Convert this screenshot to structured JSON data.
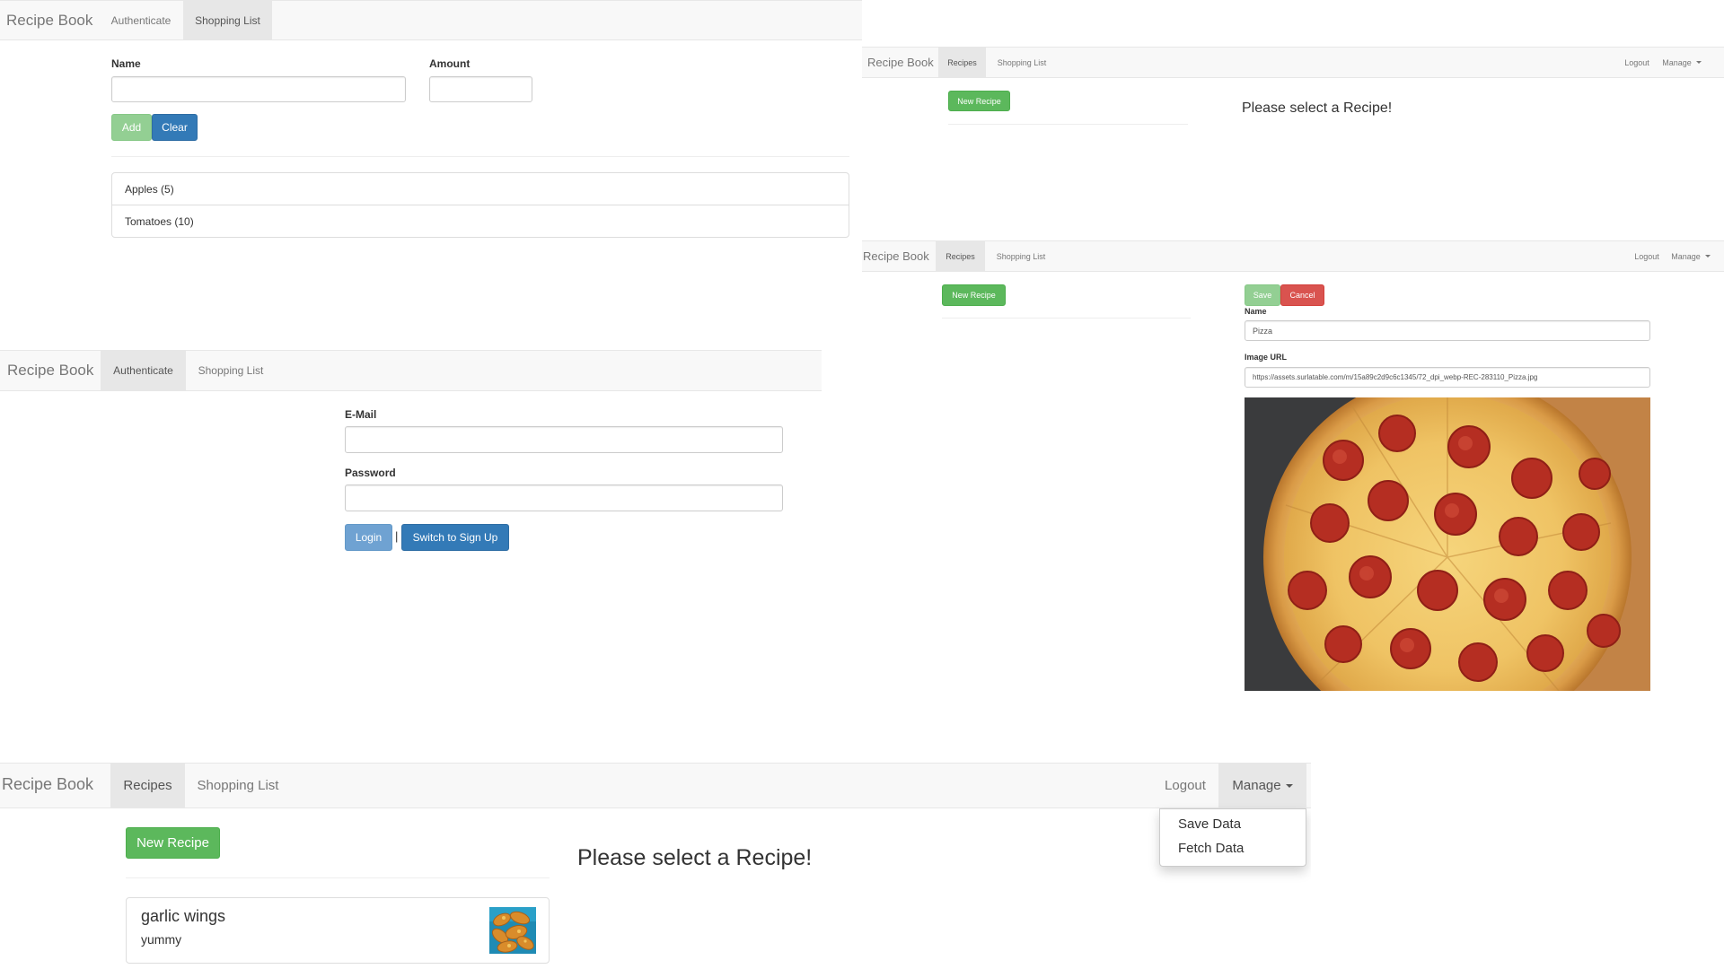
{
  "brand": "Recipe Book",
  "shopping_panel": {
    "nav": {
      "authenticate": "Authenticate",
      "shopping_list": "Shopping List"
    },
    "name_label": "Name",
    "amount_label": "Amount",
    "add_label": "Add",
    "clear_label": "Clear",
    "items": [
      "Apples (5)",
      "Tomatoes (10)"
    ]
  },
  "auth_panel": {
    "nav": {
      "authenticate": "Authenticate",
      "shopping_list": "Shopping List"
    },
    "email_label": "E-Mail",
    "password_label": "Password",
    "login_label": "Login",
    "separator": "|",
    "switch_label": "Switch to Sign Up"
  },
  "recipes_select_panel": {
    "nav": {
      "recipes": "Recipes",
      "shopping_list": "Shopping List",
      "logout": "Logout",
      "manage": "Manage"
    },
    "new_recipe_label": "New Recipe",
    "message": "Please select a Recipe!"
  },
  "recipe_edit_panel": {
    "nav": {
      "recipes": "Recipes",
      "shopping_list": "Shopping List",
      "logout": "Logout",
      "manage": "Manage"
    },
    "new_recipe_label": "New Recipe",
    "save_label": "Save",
    "cancel_label": "Cancel",
    "name_label": "Name",
    "name_value": "Pizza",
    "image_url_label": "Image URL",
    "image_url_value": "https://assets.surlatable.com/m/15a89c2d9c6c1345/72_dpi_webp-REC-283110_Pizza.jpg"
  },
  "recipes_list_panel": {
    "nav": {
      "recipes": "Recipes",
      "shopping_list": "Shopping List",
      "logout": "Logout",
      "manage": "Manage"
    },
    "new_recipe_label": "New Recipe",
    "message": "Please select a Recipe!",
    "dropdown": [
      "Save Data",
      "Fetch Data"
    ],
    "recipe": {
      "name": "garlic wings",
      "description": "yummy"
    }
  }
}
